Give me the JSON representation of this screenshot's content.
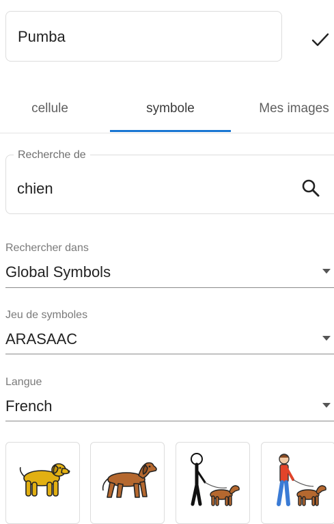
{
  "cell_name": {
    "value": "Pumba"
  },
  "icons": {
    "confirm": "check-icon",
    "search": "search-icon",
    "dropdown": "arrow-drop-down-icon"
  },
  "tabs": [
    {
      "label": "cellule",
      "active": false
    },
    {
      "label": "symbole",
      "active": true
    },
    {
      "label": "Mes images",
      "active": false
    }
  ],
  "search": {
    "legend": "Recherche de",
    "value": "chien"
  },
  "search_in": {
    "label": "Rechercher dans",
    "value": "Global Symbols"
  },
  "symbol_set": {
    "label": "Jeu de symboles",
    "value": "ARASAAC"
  },
  "language": {
    "label": "Langue",
    "value": "French"
  },
  "results": [
    {
      "name": "yellow-dog"
    },
    {
      "name": "brown-dog"
    },
    {
      "name": "walking-dog-stick-figure"
    },
    {
      "name": "walking-dog-person"
    }
  ],
  "colors": {
    "accent": "#1976d2",
    "dog_yellow": "#e2b012",
    "dog_brown": "#b5682f"
  }
}
